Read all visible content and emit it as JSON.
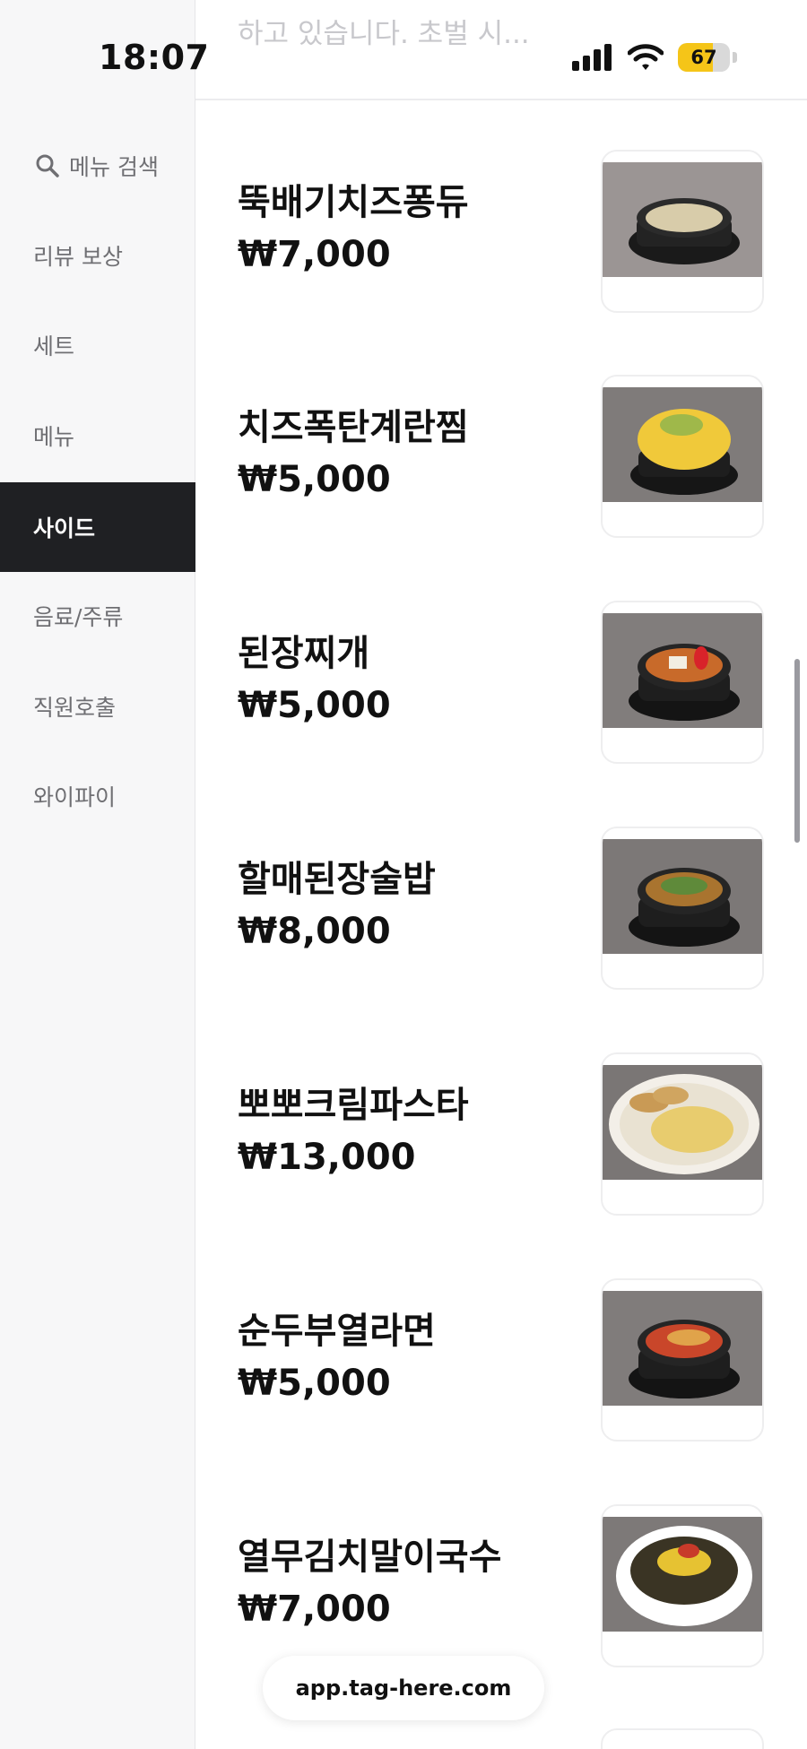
{
  "status_bar": {
    "time": "18:07",
    "battery": "67",
    "battery_level": 0.67
  },
  "header": {
    "faded_text": "하고 있습니다. 초벌 시..."
  },
  "sidebar": {
    "search_label": "메뉴 검색",
    "items": [
      {
        "label": "리뷰 보상",
        "active": false
      },
      {
        "label": "세트",
        "active": false
      },
      {
        "label": "메뉴",
        "active": false
      },
      {
        "label": "사이드",
        "active": true
      },
      {
        "label": "음료/주류",
        "active": false
      },
      {
        "label": "직원호출",
        "active": false
      },
      {
        "label": "와이파이",
        "active": false
      }
    ]
  },
  "menu": [
    {
      "name": "뚝배기치즈퐁듀",
      "price": "₩7,000",
      "icon": "cheese-fondue-dish"
    },
    {
      "name": "치즈폭탄계란찜",
      "price": "₩5,000",
      "icon": "cheese-egg-dish"
    },
    {
      "name": "된장찌개",
      "price": "₩5,000",
      "icon": "doenjang-stew-dish"
    },
    {
      "name": "할매된장술밥",
      "price": "₩8,000",
      "icon": "doenjang-rice-dish"
    },
    {
      "name": "뽀뽀크림파스타",
      "price": "₩13,000",
      "icon": "cream-pasta-dish"
    },
    {
      "name": "순두부열라면",
      "price": "₩5,000",
      "icon": "sundubu-ramen-dish"
    },
    {
      "name": "열무김치말이국수",
      "price": "₩7,000",
      "icon": "kimchi-noodle-dish"
    }
  ],
  "footer": {
    "url": "app.tag-here.com"
  },
  "colors": {
    "active_bg": "#1f2023",
    "sidebar_bg": "#f7f7f8",
    "battery": "#f5c518"
  }
}
